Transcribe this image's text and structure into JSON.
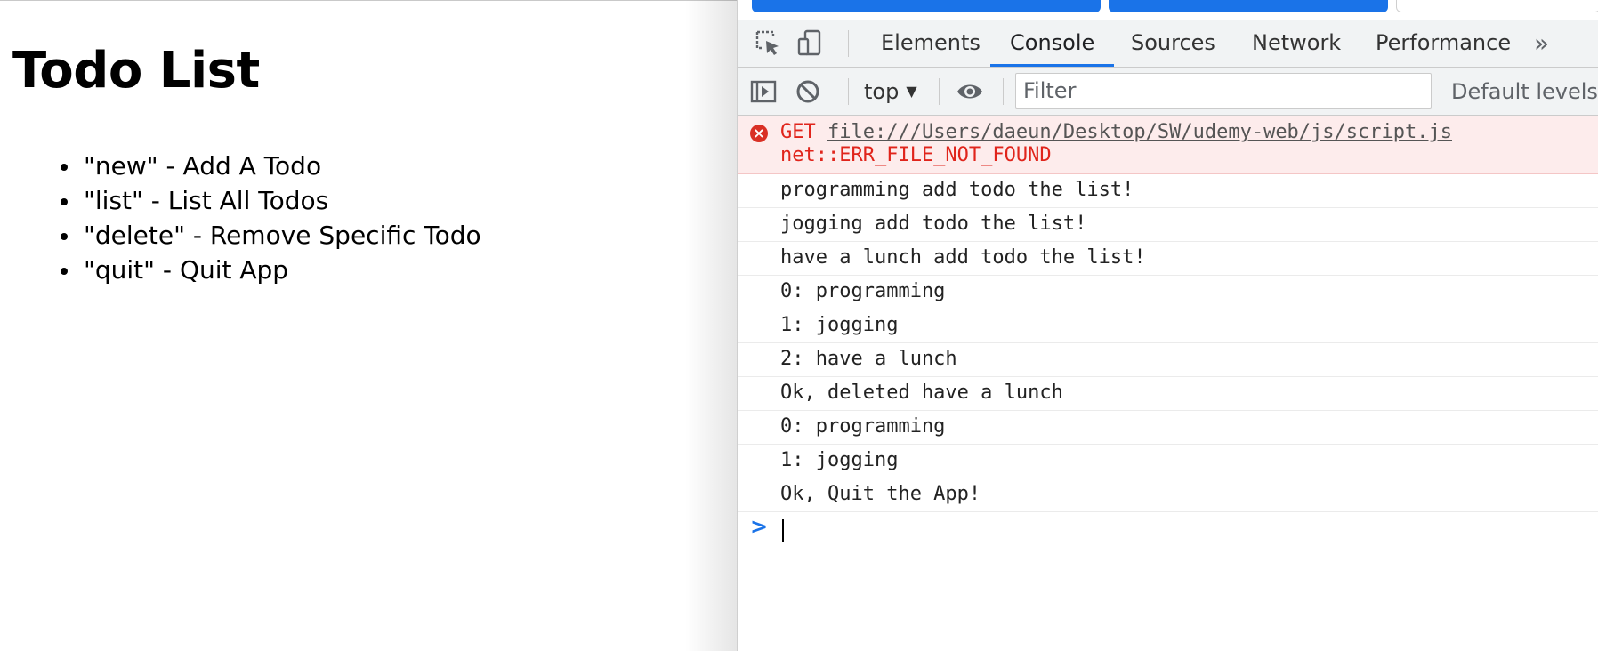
{
  "page": {
    "title": "Todo List",
    "commands": [
      "\"new\" - Add A Todo",
      "\"list\" - List All Todos",
      "\"delete\" - Remove Specific Todo",
      "\"quit\" - Quit App"
    ]
  },
  "devtools": {
    "tabs": [
      "Elements",
      "Console",
      "Sources",
      "Network",
      "Performance"
    ],
    "active_tab": "Console",
    "more_tabs_icon": "»",
    "toolbar": {
      "context": "top",
      "filter_placeholder": "Filter",
      "levels": "Default levels"
    },
    "console": {
      "error": {
        "method": "GET",
        "url": "file:///Users/daeun/Desktop/SW/udemy-web/js/script.js",
        "code": "net::ERR_FILE_NOT_FOUND"
      },
      "messages": [
        "programming add todo the list!",
        "jogging add todo the list!",
        "have a lunch add todo the list!",
        "0: programming",
        "1: jogging",
        "2: have a lunch",
        "Ok, deleted have a lunch",
        "0: programming",
        "1: jogging",
        "Ok, Quit the App!"
      ],
      "prompt_icon": ">"
    },
    "colors": {
      "accent": "#1a73e8",
      "error_text": "#e0241b",
      "error_bg": "#fdecec"
    }
  }
}
